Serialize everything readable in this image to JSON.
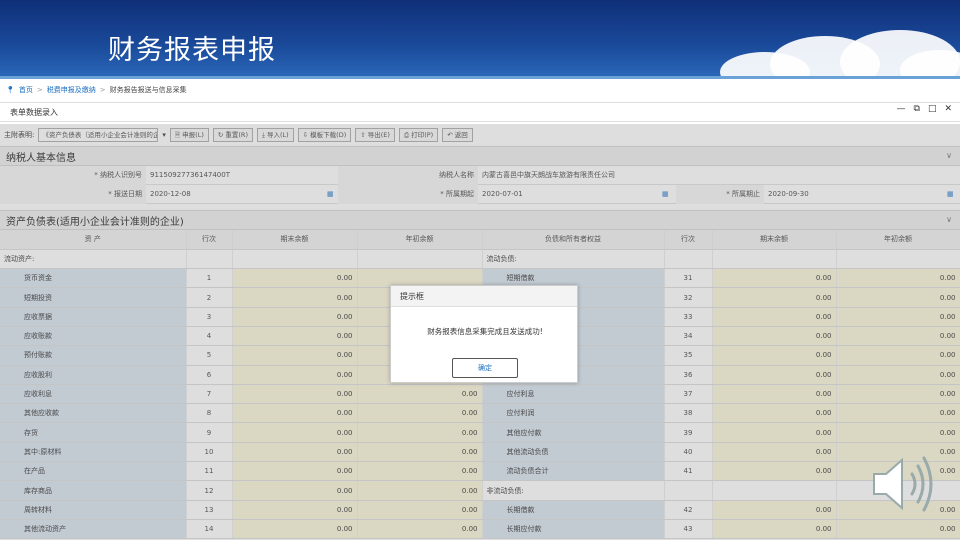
{
  "slide_title": "财务报表申报",
  "breadcrumb": [
    "首页",
    "税费申报及缴纳",
    "财务报告报送与信息采集"
  ],
  "panel_title": "表单数据录入",
  "toolbar": {
    "main_table_label": "主附表明:",
    "main_table_value": "《资产负债表（适用小企业会计准则的企业)",
    "buttons": [
      "申报(L)",
      "重置(R)",
      "导入(L)",
      "模板下载(D)",
      "导出(E)",
      "打印(P)",
      "返回"
    ]
  },
  "taxpayer_section": {
    "title": "纳税人基本信息",
    "id_label": "纳税人识别号",
    "id_value": "91150927736147400T",
    "name_label": "纳税人名称",
    "name_value": "内蒙古喜邑中旗天朗战车旅游有限责任公司",
    "submit_date_label": "报送日期",
    "submit_date_value": "2020-12-08",
    "period_start_label": "所属期起",
    "period_start_value": "2020-07-01",
    "period_end_label": "所属期止",
    "period_end_value": "2020-09-30"
  },
  "balance_sheet": {
    "title": "资产负债表(适用小企业会计准则的企业)",
    "headers": [
      "资 产",
      "行次",
      "期末余额",
      "年初余额",
      "负债和所有者权益",
      "行次",
      "期末余额",
      "年初余额"
    ],
    "rows": [
      {
        "a": "流动资产:",
        "an": "",
        "aa": "",
        "ab": "",
        "l": "流动负债:",
        "ln": "",
        "la": "",
        "lb": "",
        "hdr": true
      },
      {
        "a": "货币资金",
        "an": "1",
        "aa": "0.00",
        "ab": "",
        "l": "短期借款",
        "ln": "31",
        "la": "0.00",
        "lb": "0.00"
      },
      {
        "a": "短期投资",
        "an": "2",
        "aa": "0.00",
        "ab": "",
        "l": "",
        "ln": "32",
        "la": "0.00",
        "lb": "0.00"
      },
      {
        "a": "应收票据",
        "an": "3",
        "aa": "0.00",
        "ab": "",
        "l": "",
        "ln": "33",
        "la": "0.00",
        "lb": "0.00"
      },
      {
        "a": "应收账款",
        "an": "4",
        "aa": "0.00",
        "ab": "",
        "l": "",
        "ln": "34",
        "la": "0.00",
        "lb": "0.00"
      },
      {
        "a": "预付账款",
        "an": "5",
        "aa": "0.00",
        "ab": "",
        "l": "",
        "ln": "35",
        "la": "0.00",
        "lb": "0.00"
      },
      {
        "a": "应收股利",
        "an": "6",
        "aa": "0.00",
        "ab": "",
        "l": "",
        "ln": "36",
        "la": "0.00",
        "lb": "0.00"
      },
      {
        "a": "应收利息",
        "an": "7",
        "aa": "0.00",
        "ab": "0.00",
        "l": "应付利息",
        "ln": "37",
        "la": "0.00",
        "lb": "0.00"
      },
      {
        "a": "其他应收款",
        "an": "8",
        "aa": "0.00",
        "ab": "0.00",
        "l": "应付利润",
        "ln": "38",
        "la": "0.00",
        "lb": "0.00"
      },
      {
        "a": "存货",
        "an": "9",
        "aa": "0.00",
        "ab": "0.00",
        "l": "其他应付款",
        "ln": "39",
        "la": "0.00",
        "lb": "0.00"
      },
      {
        "a": "其中:原材料",
        "an": "10",
        "aa": "0.00",
        "ab": "0.00",
        "l": "其他流动负债",
        "ln": "40",
        "la": "0.00",
        "lb": "0.00"
      },
      {
        "a": "在产品",
        "an": "11",
        "aa": "0.00",
        "ab": "0.00",
        "l": "流动负债合计",
        "ln": "41",
        "la": "0.00",
        "lb": "0.00"
      },
      {
        "a": "库存商品",
        "an": "12",
        "aa": "0.00",
        "ab": "0.00",
        "l": "非流动负债:",
        "ln": "",
        "la": "",
        "lb": "",
        "lhdr": true
      },
      {
        "a": "周转材料",
        "an": "13",
        "aa": "0.00",
        "ab": "0.00",
        "l": "长期借款",
        "ln": "42",
        "la": "0.00",
        "lb": "0.00"
      },
      {
        "a": "其他流动资产",
        "an": "14",
        "aa": "0.00",
        "ab": "0.00",
        "l": "长期应付款",
        "ln": "43",
        "la": "0.00",
        "lb": "0.00"
      }
    ]
  },
  "dialog": {
    "title": "提示框",
    "message": "财务报表信息采集完成且发送成功!",
    "ok_label": "确定"
  }
}
